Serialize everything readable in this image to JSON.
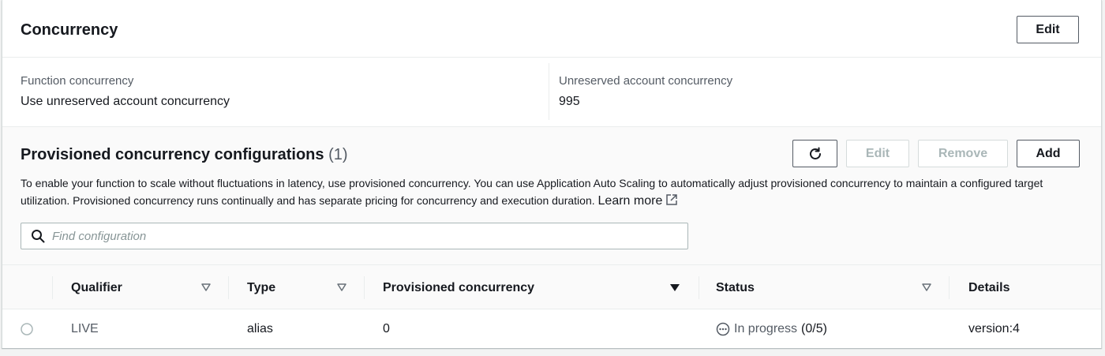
{
  "header": {
    "title": "Concurrency",
    "edit_label": "Edit"
  },
  "function_concurrency": {
    "label": "Function concurrency",
    "value": "Use unreserved account concurrency"
  },
  "unreserved": {
    "label": "Unreserved account concurrency",
    "value": "995"
  },
  "provisioned": {
    "title": "Provisioned concurrency configurations",
    "count": "(1)",
    "edit_label": "Edit",
    "remove_label": "Remove",
    "add_label": "Add",
    "description": "To enable your function to scale without fluctuations in latency, use provisioned concurrency. You can use Application Auto Scaling to automatically adjust provisioned concurrency to maintain a configured target utilization. Provisioned concurrency runs continually and has separate pricing for concurrency and execution duration.",
    "learn_more": "Learn more",
    "search_placeholder": "Find configuration"
  },
  "table": {
    "columns": [
      "Qualifier",
      "Type",
      "Provisioned concurrency",
      "Status",
      "Details"
    ],
    "rows": [
      {
        "qualifier": "LIVE",
        "type": "alias",
        "provisioned": "0",
        "status": "In progress",
        "status_count": "(0/5)",
        "details": "version:4"
      }
    ]
  },
  "icons": {
    "refresh": "refresh-icon",
    "search": "search-icon",
    "external": "external-link-icon",
    "status": "in-progress-icon"
  }
}
